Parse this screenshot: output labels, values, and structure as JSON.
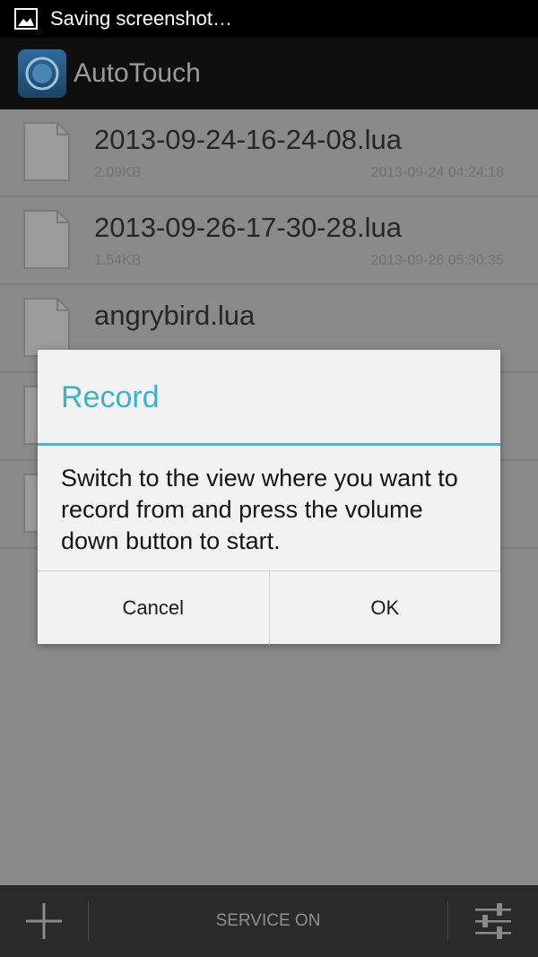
{
  "status_bar": {
    "notification_text": "Saving screenshot…",
    "icon": "picture-icon"
  },
  "action_bar": {
    "title": "AutoTouch",
    "icon": "autotouch-app-icon"
  },
  "files": [
    {
      "name": "2013-09-24-16-24-08.lua",
      "size": "2.09KB",
      "date": "2013-09-24 04:24:18"
    },
    {
      "name": "2013-09-26-17-30-28.lua",
      "size": "1.54KB",
      "date": "2013-09-26 05:30:35"
    },
    {
      "name": "angrybird.lua",
      "size": "",
      "date": ""
    },
    {
      "name": "",
      "size": "",
      "date": ""
    },
    {
      "name": "",
      "size": "",
      "date": ""
    }
  ],
  "dialog": {
    "title": "Record",
    "message": "Switch to the view where you want to record from and press the volume down button to start.",
    "cancel_label": "Cancel",
    "ok_label": "OK"
  },
  "bottom_bar": {
    "service_label": "SERVICE ON",
    "add_icon": "plus-icon",
    "settings_icon": "sliders-icon"
  },
  "colors": {
    "accent": "#3ab2d3",
    "scrim": "#8a8a8a",
    "bars": "#0f0f0f"
  }
}
